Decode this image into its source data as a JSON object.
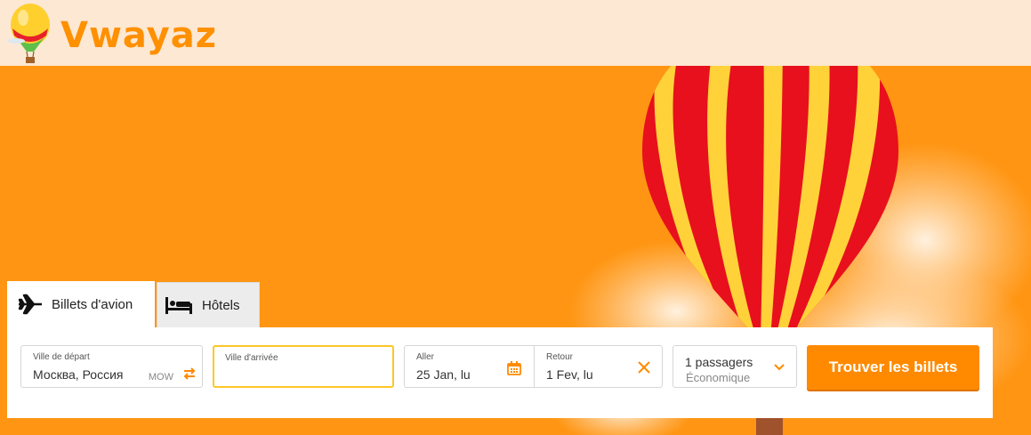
{
  "brand": {
    "name": "Vwayaz"
  },
  "tabs": [
    {
      "label": "Billets d'avion",
      "icon": "airplane-icon",
      "active": true
    },
    {
      "label": "Hôtels",
      "icon": "bed-icon",
      "active": false
    }
  ],
  "search": {
    "from": {
      "label": "Ville de départ",
      "value": "Москва, Россия",
      "code": "MOW"
    },
    "to": {
      "label": "Ville d'arrivée",
      "value": ""
    },
    "depart": {
      "label": "Aller",
      "value": "25 Jan, lu"
    },
    "return": {
      "label": "Retour",
      "value": "1 Fev, lu"
    },
    "passengers": {
      "value": "1 passagers",
      "class": "Économique"
    },
    "submit_label": "Trouver les billets"
  },
  "colors": {
    "accent": "#ff8a00",
    "hero": "#ff9512",
    "topbar": "#fde8d3",
    "focus": "#ffc629"
  }
}
